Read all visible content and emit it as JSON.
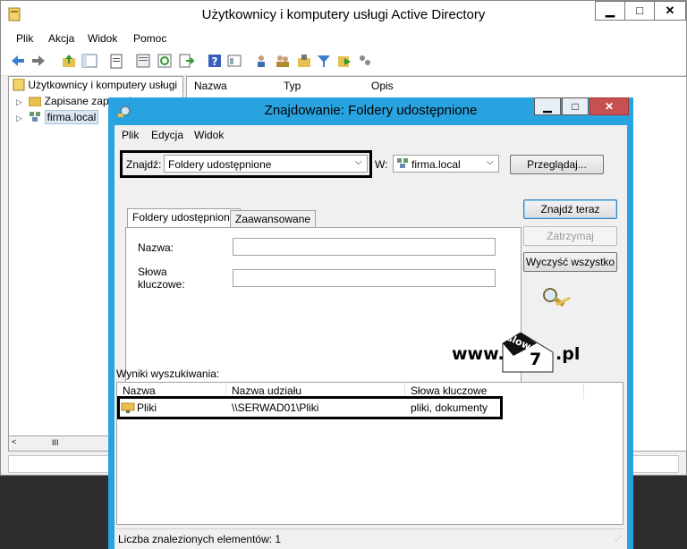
{
  "main": {
    "title": "Użytkownicy i komputery usługi Active Directory",
    "menu": [
      "Plik",
      "Akcja",
      "Widok",
      "Pomoc"
    ],
    "tree": {
      "root": "Użytkownicy i komputery usługi",
      "items": [
        "Zapisane zapytania",
        "firma.local"
      ]
    },
    "scroll_grip": "III",
    "list_columns": [
      "Nazwa",
      "Typ",
      "Opis"
    ]
  },
  "dialog": {
    "title": "Znajdowanie: Foldery udostępnione",
    "menu": [
      "Plik",
      "Edycja",
      "Widok"
    ],
    "find_label": "Znajdź:",
    "find_value": "Foldery udostępnione",
    "in_label": "W:",
    "in_value": "firma.local",
    "browse_button": "Przeglądaj...",
    "tabs": [
      "Foldery udostępnione",
      "Zaawansowane"
    ],
    "name_label": "Nazwa:",
    "keywords_label_1": "Słowa",
    "keywords_label_2": "kluczowe:",
    "find_now_button": "Znajdź teraz",
    "stop_button": "Zatrzymaj",
    "clear_button": "Wyczyść wszystko",
    "results_label": "Wyniki wyszukiwania:",
    "results_columns": [
      "Nazwa",
      "Nazwa udziału",
      "Słowa kluczowe"
    ],
    "results_rows": [
      {
        "name": "Pliki",
        "share": "\\\\SERWAD01\\Pliki",
        "keywords": "pliki, dokumenty"
      }
    ],
    "status": "Liczba znalezionych elementów: 1"
  },
  "watermark": {
    "prefix": "www.",
    "badge_top": "slow",
    "badge_num": "7",
    "suffix": ".pl"
  },
  "colors": {
    "dialog_border": "#29a3e0",
    "close_button": "#c75050"
  },
  "icons": [
    "window-app-icon",
    "back-arrow-icon",
    "forward-arrow-icon",
    "folder-up-icon",
    "find-icon",
    "share-folder-icon",
    "domain-icon",
    "search-magnifier-icon"
  ]
}
